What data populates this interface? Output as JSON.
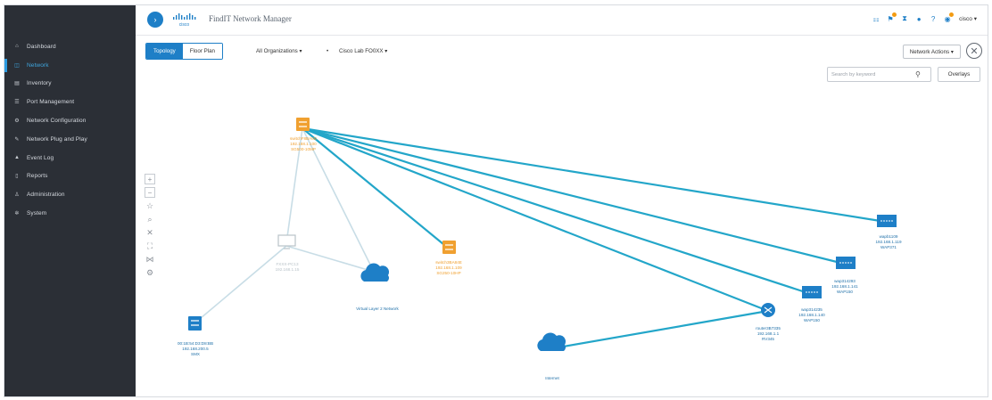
{
  "sidebar": {
    "items": [
      {
        "label": "Dashboard",
        "icon": "home-icon",
        "active": false
      },
      {
        "label": "Network",
        "icon": "network-icon",
        "active": true
      },
      {
        "label": "Inventory",
        "icon": "inventory-icon",
        "active": false
      },
      {
        "label": "Port Management",
        "icon": "port-icon",
        "active": false
      },
      {
        "label": "Network Configuration",
        "icon": "config-icon",
        "active": false
      },
      {
        "label": "Network Plug and Play",
        "icon": "pnp-icon",
        "active": false
      },
      {
        "label": "Event Log",
        "icon": "event-icon",
        "active": false
      },
      {
        "label": "Reports",
        "icon": "reports-icon",
        "active": false
      },
      {
        "label": "Administration",
        "icon": "admin-icon",
        "active": false
      },
      {
        "label": "System",
        "icon": "system-icon",
        "active": false
      }
    ]
  },
  "header": {
    "title": "FindIT Network Manager",
    "brand": "cisco",
    "user": "cisco"
  },
  "toolbar": {
    "tab_topology": "Topology",
    "tab_floorplan": "Floor Plan",
    "org_dropdown": "All Organizations",
    "site_dropdown": "Cisco Lab FO0XX",
    "network_actions": "Network Actions"
  },
  "search": {
    "placeholder": "Search by keyword"
  },
  "overlays_label": "Overlays",
  "colors": {
    "accent": "#1e7fc7",
    "link": "#23a6c9",
    "switch_orange": "#f0a030",
    "sidebar_bg": "#2b2f36"
  },
  "topology": {
    "nodes": {
      "core_switch": {
        "lines": [
          "switchF8BA6D",
          "192.168.1.100",
          "SG500-10MP"
        ]
      },
      "mid_switch": {
        "lines": [
          "switch3BA84E",
          "192.168.1.109",
          "SG250-10HP"
        ]
      },
      "pc": {
        "lines": [
          "FXXX-PC13",
          "192.168.1.15"
        ]
      },
      "cloud_l2": {
        "lines": [
          "Virtual Layer 2 Network"
        ]
      },
      "left_switch": {
        "lines": [
          "00:1B:54:D3:D8:BB",
          "192.168.200.5",
          "SMX"
        ]
      },
      "ap1": {
        "lines": [
          "wapb1109",
          "192.168.1.119",
          "WAP371"
        ]
      },
      "ap2": {
        "lines": [
          "wap314293",
          "192.168.1.141",
          "WAP150"
        ]
      },
      "ap3": {
        "lines": [
          "wap314235",
          "192.168.1.140",
          "WAP150"
        ]
      },
      "router": {
        "lines": [
          "router3B7335",
          "192.168.1.1",
          "RV345"
        ]
      },
      "internet": {
        "lines": [
          "Internet"
        ]
      }
    }
  }
}
